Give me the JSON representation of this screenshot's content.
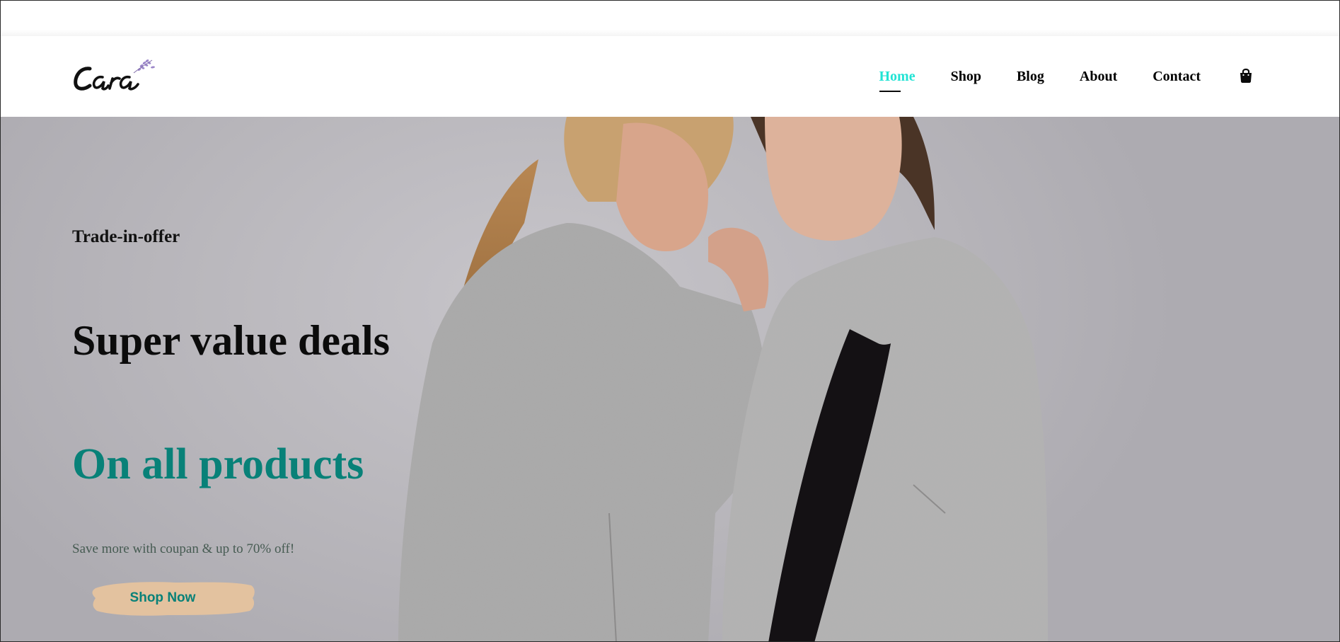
{
  "brand": {
    "logo_text": "Cara"
  },
  "nav": {
    "items": [
      {
        "label": "Home",
        "active": true
      },
      {
        "label": "Shop"
      },
      {
        "label": "Blog"
      },
      {
        "label": "About"
      },
      {
        "label": "Contact"
      }
    ],
    "cart_icon": "shopping-bag-icon"
  },
  "hero": {
    "eyebrow": "Trade-in-offer",
    "headline": "Super value deals",
    "highlight": "On all products",
    "subtext": "Save more with coupan & up to 70% off!",
    "cta_label": "Shop Now"
  },
  "colors": {
    "accent": "#088178",
    "nav_active": "#22e3d4",
    "cta_bg": "#e3c29f",
    "hero_bg": "#b9b7bc"
  }
}
